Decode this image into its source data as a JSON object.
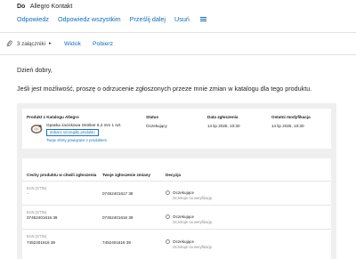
{
  "email": {
    "to_label": "Do",
    "recipient": "Allegro Kontakt",
    "actions": {
      "reply": "Odpowiedz",
      "reply_all": "Odpowiedz wszystkim",
      "forward": "Prześlij dalej",
      "delete": "Usuń"
    },
    "attachments": {
      "count_label": "3 załączniki",
      "view": "Widok",
      "download": "Pobierz"
    },
    "body": {
      "greeting": "Dzień dobry,",
      "message": "Jeśli jest możliwość, proszę o odrzucenie zgłoszonych przeze mnie zmian w katalogu dla tego produktu."
    }
  },
  "product_table": {
    "headers": {
      "product": "Produkt z Katalogu Allegro",
      "status": "Status",
      "submitted": "Data zgłoszenia",
      "modified": "Ostatni modyfikacja"
    },
    "product_name": "Opaska zaciskowa Ostriker 6,4 mm 1 szt.",
    "details_button": "Zobacz szczegóły produktu",
    "offers_link": "Twoje oferty powiązane z produktem",
    "status": "Oczekujący",
    "submitted_date": "14 lip 2025, 10:30",
    "modified_date": "14 lip 2025, 10:30"
  },
  "changes_table": {
    "headers": {
      "feature": "Cechy produktu w chwili zgłoszenia",
      "your_change": "Twoje zgłoszenie zmiany",
      "decision": "Decyzja"
    },
    "rows": [
      {
        "label": "EAN (GTIN)",
        "current": "-",
        "proposed": "07452401617 38",
        "decision": "Oczekujące",
        "decision_note": "Oczekuje na weryfikację"
      },
      {
        "label": "EAN (GTIN)",
        "current": "07452401616 39",
        "proposed": "07452401616 39",
        "decision": "Oczekujące",
        "decision_note": "Oczekuje na weryfikację"
      },
      {
        "label": "EAN (GTIN)",
        "current": "7452401616 39",
        "proposed": "7452401616 39",
        "decision": "Oczekujące",
        "decision_note": "Oczekuje na weryfikację"
      }
    ]
  },
  "colors": {
    "accent": "#0f6cbd",
    "link": "#1a73c4",
    "panel_bg": "#efefef"
  },
  "icons": {
    "menu": "hamburger-menu-icon",
    "attachment": "paperclip-icon",
    "chevron": "chevron-right-icon",
    "radio": "radio-circle-icon"
  }
}
